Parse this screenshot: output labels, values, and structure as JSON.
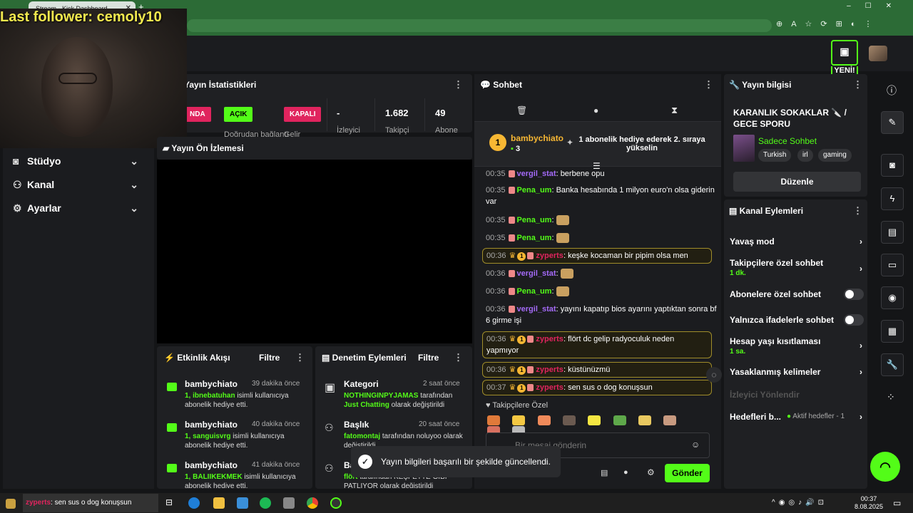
{
  "browser": {
    "tab_title": "Stream - Kick Dashboard",
    "new_tab": "+"
  },
  "header": {
    "new_badge": "YENİ!"
  },
  "overlay": {
    "last_follower": "Last follower: cemoly10"
  },
  "nav": {
    "items": [
      {
        "label": "Stüdyo",
        "icon": "studio-icon"
      },
      {
        "label": "Kanal",
        "icon": "channel-icon"
      },
      {
        "label": "Ayarlar",
        "icon": "gear-icon"
      }
    ]
  },
  "stats": {
    "title": "Yayın İstatistikleri",
    "badge_live": "NDA",
    "badge_open": "AÇIK",
    "badge_open_label": "Doğrudan bağlantı",
    "badge_closed": "KAPALI",
    "badge_closed_label": "Gelir",
    "viewers": "-",
    "viewers_label": "İzleyici",
    "followers": "1.682",
    "followers_label": "Takipçi",
    "subs": "49",
    "subs_label": "Abone"
  },
  "preview": {
    "title": "Yayın Ön İzlemesi"
  },
  "activity": {
    "title": "Etkinlik Akışı",
    "filter": "Filtre",
    "items": [
      {
        "name": "bambychiato",
        "time": "39 dakika önce",
        "count": "1,",
        "user": "ibnebatuhan",
        "text": "isimli kullanıcıya abonelik hediye etti."
      },
      {
        "name": "bambychiato",
        "time": "40 dakika önce",
        "count": "1,",
        "user": "sanguisvrg",
        "text": "isimli kullanıcıya abonelik hediye etti."
      },
      {
        "name": "bambychiato",
        "time": "41 dakika önce",
        "count": "1,",
        "user": "BALIIKEKMEK",
        "text": "isimli kullanıcıya abonelik hediye etti."
      }
    ]
  },
  "moderation": {
    "title": "Denetim Eylemleri",
    "filter": "Filtre",
    "items": [
      {
        "name": "Kategori",
        "time": "2 saat önce",
        "user": "NOTHINGINPYJAMAS",
        "mid": "tarafından",
        "value": "Just Chatting",
        "text": "olarak değiştirildi"
      },
      {
        "name": "Başlık",
        "time": "20 saat önce",
        "user": "fatomontaj",
        "mid": "tarafından noluyoo",
        "value": "",
        "text": "olarak değiştirildi"
      },
      {
        "name": "Başlık",
        "time": "",
        "user": "flört",
        "mid": "tarafından KEŞFETTE",
        "value": "",
        "text": "GİBİ PATLIYOR olarak değiştirildi"
      }
    ]
  },
  "chat": {
    "title": "Sohbet",
    "pinned_user": "bambychiato",
    "pinned_count": "3",
    "pinned_text": "1 abonelik hediye ederek 2. sıraya yükselin",
    "messages": [
      {
        "time": "00:35",
        "user": "vergil_stat",
        "cls": "u-verg",
        "text": "berbene opu",
        "hl": false
      },
      {
        "time": "00:35",
        "user": "Pena_um",
        "cls": "u-pena",
        "text": "Banka hesabında 1 milyon euro'n olsa giderin var",
        "hl": false
      },
      {
        "time": "00:35",
        "user": "Pena_um",
        "cls": "u-pena",
        "text": "",
        "hl": false
      },
      {
        "time": "00:35",
        "user": "Pena_um",
        "cls": "u-pena",
        "text": "",
        "hl": false
      },
      {
        "time": "00:36",
        "user": "zyperts",
        "cls": "u-zyp",
        "text": "keşke kocaman bir pipim olsa men",
        "hl": true
      },
      {
        "time": "00:36",
        "user": "vergil_stat",
        "cls": "u-verg",
        "text": "",
        "hl": false
      },
      {
        "time": "00:36",
        "user": "Pena_um",
        "cls": "u-pena",
        "text": "",
        "hl": false
      },
      {
        "time": "00:36",
        "user": "vergil_stat",
        "cls": "u-verg",
        "text": "yayını kapatıp bios ayarını yaptıktan sonra bf 6 girme işi",
        "hl": false
      },
      {
        "time": "00:36",
        "user": "zyperts",
        "cls": "u-zyp",
        "text": "flört dc gelip radyoculuk neden yapmıyor",
        "hl": true
      },
      {
        "time": "00:36",
        "user": "zyperts",
        "cls": "u-zyp",
        "text": "küstünüzmü",
        "hl": true
      },
      {
        "time": "00:37",
        "user": "zyperts",
        "cls": "u-zyp",
        "text": "sen sus o dog konuşsun",
        "hl": true
      }
    ],
    "followers_only": "Takipçilere Özel",
    "input_placeholder": "Bir mesaj gönderin",
    "send": "Gönder"
  },
  "info": {
    "title": "Yayın bilgisi",
    "stream_title": "KARANLIK SOKAKLAR 🔪 / GECE SPORU",
    "category": "Sadece Sohbet",
    "tags": [
      "Turkish",
      "irl",
      "gaming"
    ],
    "edit": "Düzenle"
  },
  "actions": {
    "title": "Kanal Eylemleri",
    "rows": [
      {
        "label": "Yavaş mod",
        "sub": "",
        "kind": "arrow"
      },
      {
        "label": "Takipçilere özel sohbet",
        "sub": "1 dk.",
        "kind": "arrow"
      },
      {
        "label": "Abonelere özel sohbet",
        "sub": "",
        "kind": "toggle"
      },
      {
        "label": "Yalnızca ifadelerle sohbet",
        "sub": "",
        "kind": "toggle"
      },
      {
        "label": "Hesap yaşı kısıtlaması",
        "sub": "1 sa.",
        "kind": "arrow"
      },
      {
        "label": "Yasaklanmış kelimeler",
        "sub": "",
        "kind": "arrow"
      },
      {
        "label": "İzleyici Yönlendir",
        "sub": "",
        "kind": "disabled"
      },
      {
        "label": "Hedefleri b...",
        "sub": "",
        "kind": "goals"
      }
    ],
    "goals_status": "Aktif hedefler - 1"
  },
  "toast": {
    "text": "Yayın bilgileri başarılı bir şekilde güncellendi."
  },
  "taskbar": {
    "chat_user": "zyperts",
    "chat_text": ": sen sus o dog konuşsun",
    "time": "00:37",
    "date": "8.08.2025"
  },
  "colors": {
    "accent": "#53fc18",
    "bg": "#141517",
    "panel": "#1f2023",
    "danger": "#e0245e"
  }
}
